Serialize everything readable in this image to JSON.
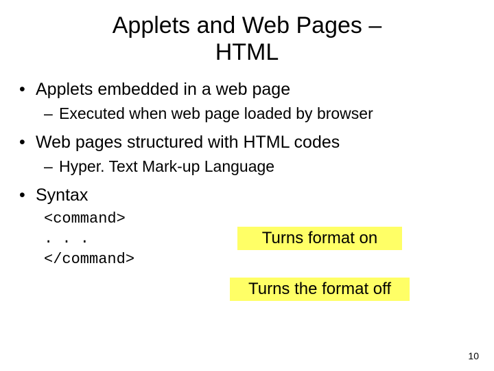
{
  "title_line1": "Applets and Web Pages –",
  "title_line2": "HTML",
  "bullets": {
    "b1": "Applets embedded in a web page",
    "b1_sub": "Executed when web page loaded by browser",
    "b2": "Web pages structured with HTML codes",
    "b2_sub": "Hyper. Text Mark-up Language",
    "b3": "Syntax"
  },
  "code": {
    "open": "<command>",
    "mid": " . . .",
    "close": "</command>"
  },
  "highlights": {
    "on": "Turns format on",
    "off": "Turns the format off"
  },
  "page_number": "10"
}
